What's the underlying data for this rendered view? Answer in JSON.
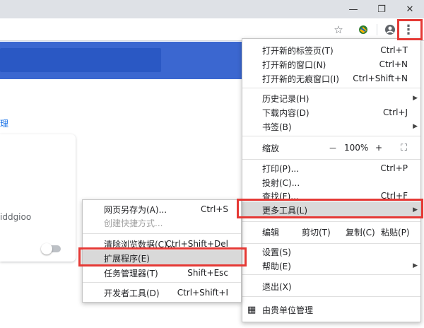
{
  "window": {
    "minimize_glyph": "—",
    "restore_glyph": "❐",
    "close_glyph": "✕"
  },
  "toolbar": {
    "star_glyph": "☆",
    "profile_glyph": "●",
    "menu_glyph": "⋮"
  },
  "page": {
    "manage_link": "理",
    "extension_id_fragment": "iddgioo"
  },
  "main_menu": {
    "new_tab": {
      "label": "打开新的标签页(T)",
      "shortcut": "Ctrl+T"
    },
    "new_window": {
      "label": "打开新的窗口(N)",
      "shortcut": "Ctrl+N"
    },
    "incognito": {
      "label": "打开新的无痕窗口(I)",
      "shortcut": "Ctrl+Shift+N"
    },
    "history": {
      "label": "历史记录(H)"
    },
    "downloads": {
      "label": "下载内容(D)",
      "shortcut": "Ctrl+J"
    },
    "bookmarks": {
      "label": "书签(B)"
    },
    "zoom": {
      "label": "缩放",
      "minus": "－",
      "value": "100%",
      "plus": "+",
      "fullscreen": "⛶"
    },
    "print": {
      "label": "打印(P)...",
      "shortcut": "Ctrl+P"
    },
    "cast": {
      "label": "投射(C)..."
    },
    "find": {
      "label": "查找(F)...",
      "shortcut": "Ctrl+F"
    },
    "more_tools": {
      "label": "更多工具(L)"
    },
    "edit": {
      "label": "编辑",
      "cut": "剪切(T)",
      "copy": "复制(C)",
      "paste": "粘贴(P)"
    },
    "settings": {
      "label": "设置(S)"
    },
    "help": {
      "label": "帮助(E)"
    },
    "exit": {
      "label": "退出(X)"
    },
    "managed": {
      "label": "由贵单位管理",
      "icon_glyph": "▦"
    }
  },
  "sub_menu": {
    "save_page": {
      "label": "网页另存为(A)...",
      "shortcut": "Ctrl+S"
    },
    "create_shortcut": {
      "label": "创建快捷方式..."
    },
    "clear_data": {
      "label": "清除浏览数据(C)...",
      "shortcut": "Ctrl+Shift+Del"
    },
    "extensions": {
      "label": "扩展程序(E)"
    },
    "task_manager": {
      "label": "任务管理器(T)",
      "shortcut": "Shift+Esc"
    },
    "dev_tools": {
      "label": "开发者工具(D)",
      "shortcut": "Ctrl+Shift+I"
    }
  },
  "colors": {
    "highlight_box": "#e53935",
    "header_blue": "#3b67d0",
    "link_blue": "#1a73e8"
  }
}
